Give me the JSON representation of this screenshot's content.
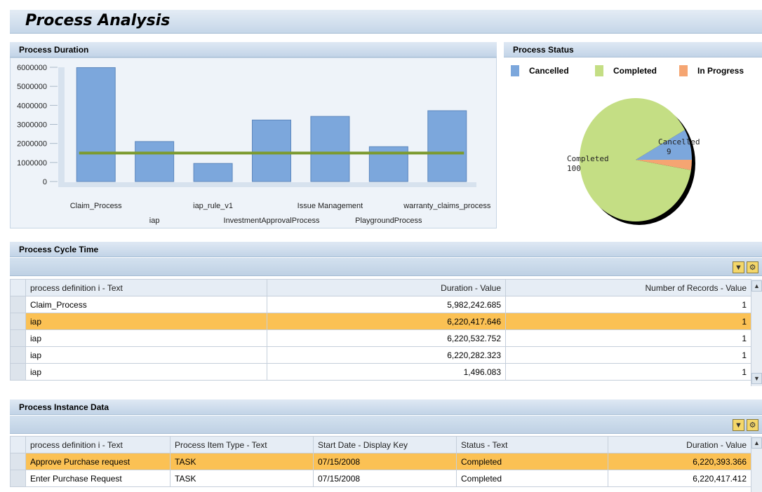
{
  "page": {
    "title": "Process Analysis"
  },
  "duration_panel": {
    "title": "Process Duration"
  },
  "status_panel": {
    "title": "Process Status",
    "legend": [
      {
        "label": "Cancelled",
        "color": "#7ca7dc"
      },
      {
        "label": "Completed",
        "color": "#c4de84"
      },
      {
        "label": "In Progress",
        "color": "#f5a572"
      }
    ]
  },
  "chart_data": [
    {
      "type": "bar",
      "title": "Process Duration",
      "categories": [
        "Claim_Process",
        "iap",
        "iap_rule_v1",
        "InvestmentApprovalProcess",
        "Issue Management",
        "PlaygroundProcess",
        "warranty_claims_process"
      ],
      "values": [
        5982243,
        2100000,
        950000,
        3230000,
        3420000,
        1830000,
        3720000
      ],
      "reference_line": 1496083,
      "y_ticks": [
        "6000000",
        "5000000",
        "4000000",
        "3000000",
        "2000000",
        "1000000",
        "0"
      ],
      "ylim": [
        0,
        6000000
      ],
      "bar_color": "#7ca7dc",
      "line_color": "#7c9a2e"
    },
    {
      "type": "pie",
      "title": "Process Status",
      "categories": [
        "Cancelled",
        "Completed",
        "In Progress"
      ],
      "values": [
        9,
        100,
        3
      ],
      "labels": [
        {
          "name": "Cancelled",
          "value": "9"
        },
        {
          "name": "Completed",
          "value": "100"
        }
      ],
      "colors": [
        "#7ca7dc",
        "#c4de84",
        "#f5a572"
      ]
    }
  ],
  "cycle_panel": {
    "title": "Process Cycle Time",
    "columns": [
      "process definition i - Text",
      "Duration - Value",
      "Number of Records - Value"
    ],
    "rows": [
      [
        "Claim_Process",
        "5,982,242.685",
        "1"
      ],
      [
        "iap",
        "6,220,417.646",
        "1"
      ],
      [
        "iap",
        "6,220,532.752",
        "1"
      ],
      [
        "iap",
        "6,220,282.323",
        "1"
      ],
      [
        "iap",
        "1,496.083",
        "1"
      ]
    ],
    "highlighted_row": 1
  },
  "instance_panel": {
    "title": "Process Instance Data",
    "columns": [
      "process definition i - Text",
      "Process Item Type - Text",
      "Start Date - Display Key",
      "Status - Text",
      "Duration - Value"
    ],
    "rows": [
      [
        "Approve Purchase request",
        "TASK",
        "07/15/2008",
        "Completed",
        "6,220,393.366"
      ],
      [
        "Enter Purchase Request",
        "TASK",
        "07/15/2008",
        "Completed",
        "6,220,417.412"
      ]
    ],
    "highlighted_row": 0
  },
  "toolbar": {
    "icons": [
      "filter-icon",
      "settings-wrench-icon"
    ]
  }
}
